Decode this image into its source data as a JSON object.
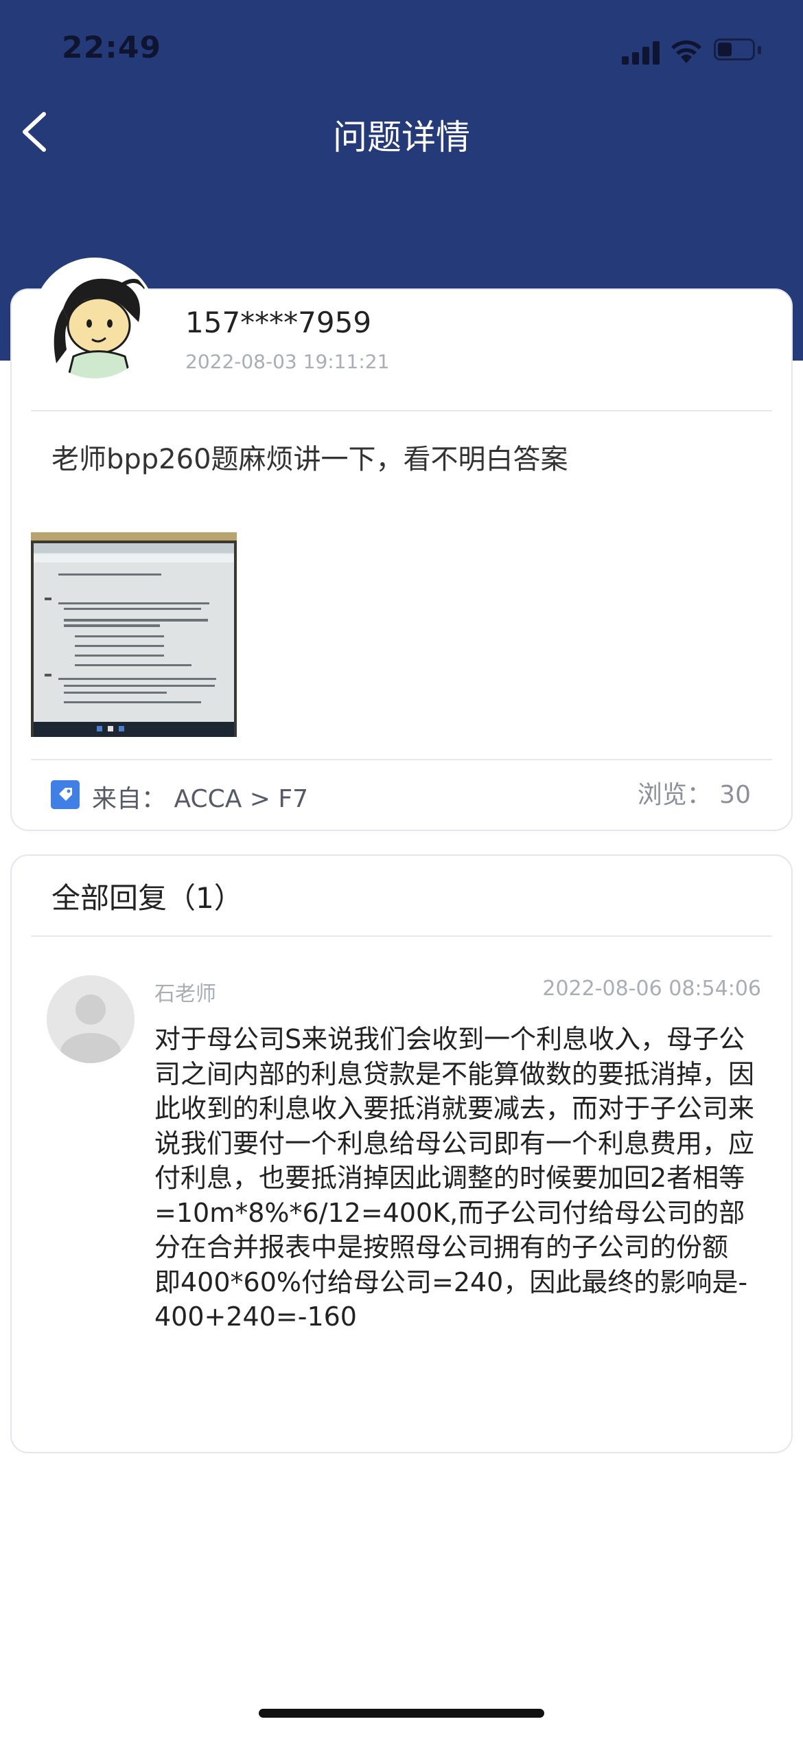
{
  "status_bar": {
    "time": "22:49"
  },
  "header": {
    "title": "问题详情"
  },
  "question": {
    "user": "157****7959",
    "time": "2022-08-03 19:11:21",
    "text": "老师bpp260题麻烦讲一下，看不明白答案",
    "source_label": "来自：  ACCA > F7",
    "views": "浏览：  30"
  },
  "replies": {
    "heading": "全部回复（1）",
    "items": [
      {
        "author": "石老师",
        "time": "2022-08-06 08:54:06",
        "body": "对于母公司S来说我们会收到一个利息收入，母子公司之间内部的利息贷款是不能算做数的要抵消掉，因此收到的利息收入要抵消就要减去，而对于子公司来说我们要付一个利息给母公司即有一个利息费用，应付利息，也要抵消掉因此调整的时候要加回2者相等=10m*8%*6/12=400K,而子公司付给母公司的部分在合并报表中是按照母公司拥有的子公司的份额 即400*60%付给母公司=240，因此最终的影响是-400+240=-160"
      }
    ]
  },
  "colors": {
    "header_bg": "#253a78",
    "tag_icon": "#3f7fe6"
  },
  "icons": [
    "back-arrow-icon",
    "signal-icon",
    "wifi-icon",
    "battery-icon",
    "tag-icon"
  ]
}
